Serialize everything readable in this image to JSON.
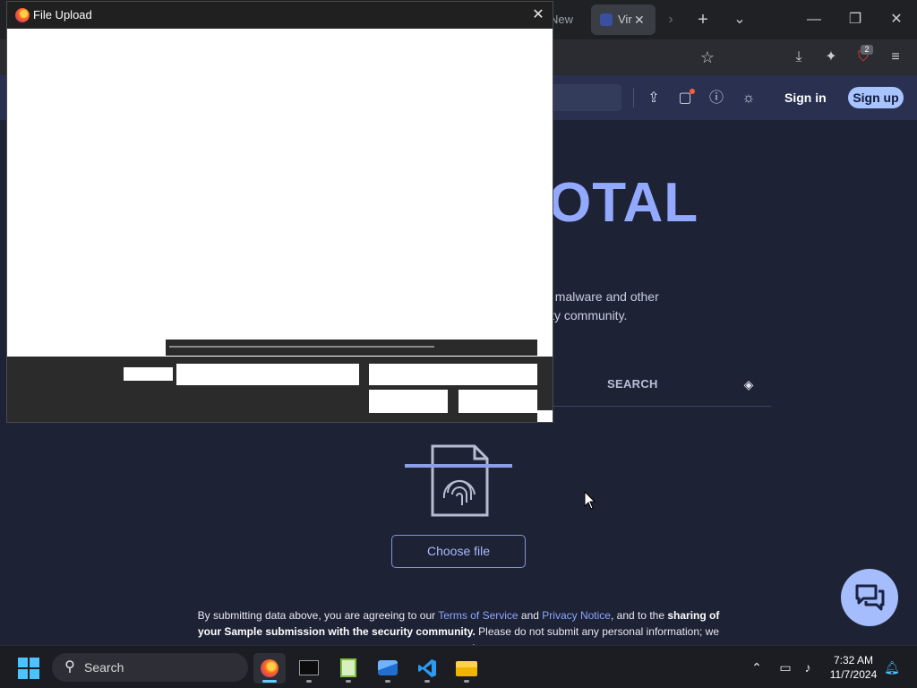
{
  "browser": {
    "tab_partial_label": "New",
    "active_tab_label": "Vir",
    "close_tab_glyph": "✕",
    "extension_badge_count": "2"
  },
  "site_header": {
    "sign_in_label": "Sign in",
    "sign_up_label": "Sign up",
    "icons": [
      "upload-icon",
      "chat-notification-icon",
      "help-icon",
      "theme-toggle-icon"
    ],
    "notification_dot_color": "#ff5c3a"
  },
  "page": {
    "logo_visible_text": "OTAL",
    "description_line1": "t malware and other",
    "description_line2": "ity community.",
    "search_tab_label": "SEARCH",
    "choose_file_label": "Choose file",
    "terms": {
      "part1": "By submitting data above, you are agreeing to our ",
      "terms_link": "Terms of Service",
      "part2": " and ",
      "privacy_link": "Privacy Notice",
      "part3": ", and to the ",
      "bold1": "sharing of your Sample submission with the security community.",
      "part4": " Please do not submit any personal information; we are not"
    }
  },
  "dialog": {
    "title": "File Upload",
    "close_glyph": "✕"
  },
  "taskbar": {
    "search_placeholder": "Search",
    "time": "7:32 AM",
    "date": "11/7/2024",
    "apps": [
      "firefox",
      "terminal",
      "notepad-plus-plus",
      "photos",
      "vscode",
      "file-explorer"
    ]
  },
  "colors": {
    "page_bg": "#1e2235",
    "brand_accent": "#93a9ff",
    "sign_up_bg": "#a7c4ff",
    "taskbar_accent": "#60cdff"
  }
}
